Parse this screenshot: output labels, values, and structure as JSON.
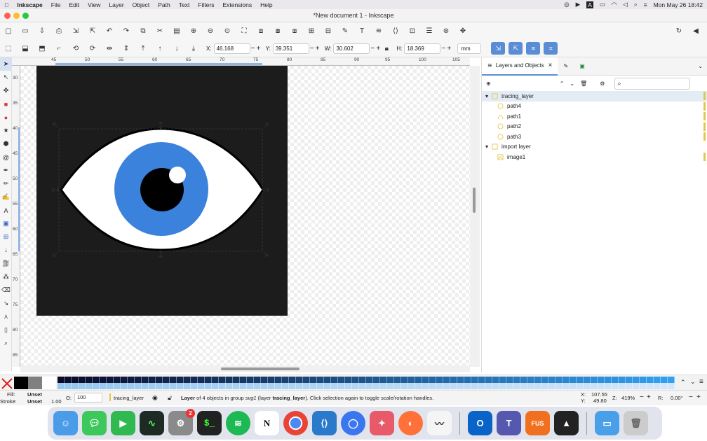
{
  "menubar": {
    "app": "Inkscape",
    "items": [
      "File",
      "Edit",
      "View",
      "Layer",
      "Object",
      "Path",
      "Text",
      "Filters",
      "Extensions",
      "Help"
    ],
    "datetime": "Mon May 26  18:42"
  },
  "window": {
    "title": "*New document 1 - Inkscape"
  },
  "controls": {
    "x_label": "X:",
    "x": "46.168",
    "y_label": "Y:",
    "y": "39.351",
    "w_label": "W:",
    "w": "30.602",
    "h_label": "H:",
    "h": "18.369",
    "unit": "mm"
  },
  "ruler": {
    "h_ticks": [
      "45",
      "50",
      "55",
      "60",
      "65",
      "70",
      "75",
      "80",
      "85",
      "90",
      "95",
      "100",
      "105"
    ],
    "v_ticks": [
      "30",
      "35",
      "40",
      "45",
      "50",
      "55",
      "60",
      "65",
      "70",
      "75",
      "80",
      "85"
    ]
  },
  "panel": {
    "tab_label": "Layers and Objects",
    "close": "×",
    "search_icon": "search-icon",
    "tree": [
      {
        "label": "tracing_layer",
        "type": "layer",
        "expanded": true,
        "selected": true
      },
      {
        "label": "path4",
        "type": "circle",
        "indent": 1
      },
      {
        "label": "path1",
        "type": "path",
        "indent": 1
      },
      {
        "label": "path2",
        "type": "circle",
        "indent": 1
      },
      {
        "label": "path3",
        "type": "circle",
        "indent": 1
      },
      {
        "label": "import layer",
        "type": "layer",
        "expanded": true
      },
      {
        "label": "image1",
        "type": "image",
        "indent": 1
      }
    ]
  },
  "status": {
    "fill_label": "Fill:",
    "fill_value": "Unset",
    "stroke_label": "Stroke:",
    "stroke_value": "Unset",
    "stroke_width": "1.00",
    "opacity_label": "O:",
    "opacity": "100",
    "layer_name": "tracing_layer",
    "message_bold": "Layer",
    "message_rest": " of 4 objects in group ",
    "message_svg": "svg1",
    "message_mid": " (layer ",
    "message_layer": "tracing_layer",
    "message_end": "). Click selection again to toggle scale/rotation handles.",
    "cx_label": "X:",
    "cx": "107.55",
    "cy_label": "Y:",
    "cy": "49.80",
    "zoom_label": "Z:",
    "zoom": "419%",
    "rot_label": "R:",
    "rotation": "0.00°"
  },
  "dock": {
    "badge": "2",
    "apps": [
      "Finder",
      "Messages",
      "FaceTime",
      "Activity Monitor",
      "System Settings",
      "Terminal",
      "Spotify",
      "Notion",
      "Chrome",
      "VS Code",
      "Signal",
      "Affinity",
      "Firefox",
      "Freeform",
      "Outlook",
      "Teams",
      "Fusion",
      "Inkscape",
      "Folder",
      "Trash"
    ],
    "fusion_label": "FUS"
  },
  "colors": {
    "accent": "#5b8dd6",
    "iris": "#3b82dc",
    "page": "#1c1c1c",
    "layer_marker": "#e5c64a"
  }
}
